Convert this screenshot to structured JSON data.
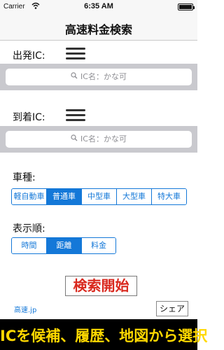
{
  "status_bar": {
    "carrier": "Carrier",
    "time": "6:35 AM"
  },
  "nav": {
    "title": "高速料金検索"
  },
  "departure": {
    "label": "出発IC:",
    "search_placeholder": "IC名：かな可"
  },
  "arrival": {
    "label": "到着IC:",
    "search_placeholder": "IC名：かな可"
  },
  "vehicle": {
    "label": "車種:",
    "options": [
      "軽自動車",
      "普通車",
      "中型車",
      "大型車",
      "特大車"
    ],
    "selected": "普通車"
  },
  "sort": {
    "label": "表示順:",
    "options": [
      "時間",
      "距離",
      "料金"
    ],
    "selected": "距離"
  },
  "start_button": "検索開始",
  "link": "高速.jp",
  "share_button": "シェア",
  "footer": "ICを候補、履歴、地図から選択",
  "colors": {
    "accent": "#1478d8",
    "start_text": "#d9281e",
    "footer_text": "#ffd800",
    "search_band": "#c9c9ce"
  }
}
